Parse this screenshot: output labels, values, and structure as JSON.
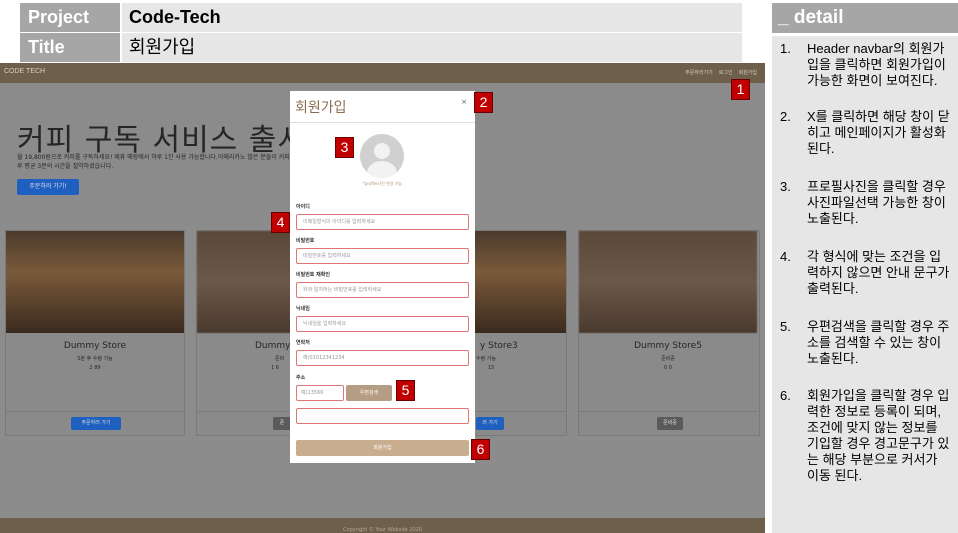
{
  "spec": {
    "project_label": "Project",
    "project_value": "Code-Tech",
    "title_label": "Title",
    "title_value": "회원가입"
  },
  "screen": {
    "brand": "CODE TECH",
    "nav_links": [
      "주문하러가기",
      "로그인",
      "회원가입"
    ],
    "hero": {
      "title": "커피 구독 서비스 출시!",
      "desc": "월 19,800원으로 커피를 구독하세요! 제휴 매장에서 하루 1잔 사용 가능합니다.아메리카노 많은 분들이 커피테로로 하루 평균 3분의 시간을 절약하셨습니다.",
      "button": "주문하러 가기!"
    },
    "cards": [
      {
        "name": "Dummy Store",
        "status": "5분 후 수령 가능",
        "counts": "2  89",
        "button": "주문하러 가기",
        "button_type": "blue"
      },
      {
        "name": "Dummy",
        "status": "준비",
        "counts": "1  6",
        "button": "준",
        "button_type": "gray"
      },
      {
        "name": "y Store3",
        "status": "수령 가능",
        "counts": "15",
        "button": "러 가기",
        "button_type": "blue"
      },
      {
        "name": "Dummy Store5",
        "status": "준비중",
        "counts": "0  0",
        "button": "준비중",
        "button_type": "gray"
      }
    ],
    "footer": "Copyright © Your Website 2020"
  },
  "modal": {
    "title": "회원가입",
    "close": "×",
    "avatar_caption": "*profile사진 변경 가능",
    "fields": [
      {
        "label": "아이디",
        "placeholder": "이메일형식의 아이디를 입력하세요"
      },
      {
        "label": "비밀번호",
        "placeholder": "비밀번호를 입력하세요"
      },
      {
        "label": "비밀번호 재확인",
        "placeholder": "위와 일치하는 비밀번호를 입력하세요"
      },
      {
        "label": "닉네임",
        "placeholder": "닉네임을 입력하세요"
      },
      {
        "label": "연락처",
        "placeholder": "예)01012341234"
      }
    ],
    "address_label": "주소",
    "zip_placeholder": "예)13566",
    "zip_button": "우편검색",
    "submit": "회원가입"
  },
  "markers": [
    "1",
    "2",
    "3",
    "4",
    "5",
    "6"
  ],
  "detail": {
    "heading": "_ detail",
    "items": [
      {
        "num": "1.",
        "text": "Header navbar의 회원가입을 클릭하면 회원가입이 가능한 화면이 보여진다."
      },
      {
        "num": "2.",
        "text": "X를 클릭하면 해당 창이 닫히고 메인페이지가 활성화 된다."
      },
      {
        "num": "3.",
        "text": "프로필사진을 클릭할 경우 사진파일선택 가능한 창이 노출된다."
      },
      {
        "num": "4.",
        "text": "각 형식에 맞는 조건을 입력하지 않으면 안내 문구가 출력된다."
      },
      {
        "num": "5.",
        "text": "우편검색을 클릭할 경우 주소를 검색할 수 있는 창이 노출된다."
      },
      {
        "num": "6.",
        "text": "회원가입을 클릭할 경우 입력한 정보로 등록이 되며, 조건에 맞지 않는 정보를 기입할 경우 경고문구가 있는 해당 부분으로 커서가 이동 된다."
      }
    ]
  },
  "colors": {
    "marker": "#c00000",
    "navbar": "#6e5f4b",
    "modal_accent": "#8a6e52"
  }
}
